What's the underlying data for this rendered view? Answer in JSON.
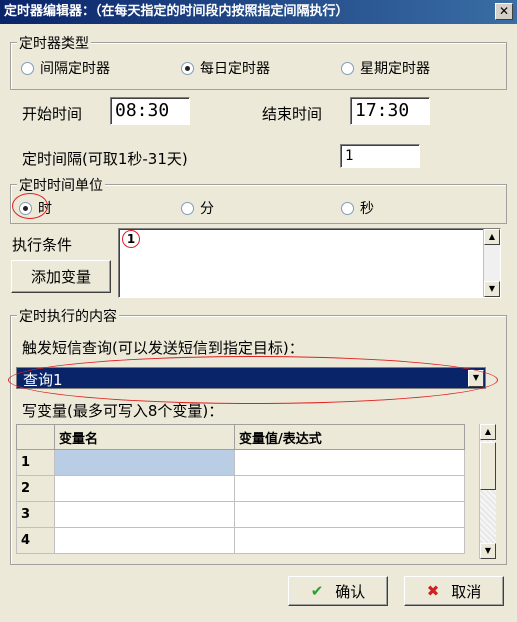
{
  "window": {
    "title": "定时器编辑器：（在每天指定的时间段内按照指定间隔执行）",
    "close_label": "✕"
  },
  "timer_type": {
    "title": "定时器类型",
    "options": [
      "间隔定时器",
      "每日定时器",
      "星期定时器"
    ],
    "selected": "每日定时器"
  },
  "time_range": {
    "start_label": "开始时间",
    "start_value": "08:30",
    "end_label": "结束时间",
    "end_value": "17:30"
  },
  "interval": {
    "label": "定时间隔(可取1秒-31天)",
    "value": "1"
  },
  "unit": {
    "title": "定时时间单位",
    "options": [
      "时",
      "分",
      "秒"
    ],
    "selected": "时",
    "marker": "1"
  },
  "condition": {
    "label": "执行条件",
    "add_var_label": "添加变量",
    "marker": "1",
    "value": ""
  },
  "content": {
    "title": "定时执行的内容",
    "trigger_label": "触发短信查询(可以发送短信到指定目标)：",
    "trigger_value": "查询1",
    "write_label": "写变量(最多可写入8个变量)：",
    "columns": [
      "",
      "变量名",
      "变量值/表达式"
    ],
    "rows": [
      {
        "index": "1",
        "name": "",
        "expr": ""
      },
      {
        "index": "2",
        "name": "",
        "expr": ""
      },
      {
        "index": "3",
        "name": "",
        "expr": ""
      },
      {
        "index": "4",
        "name": "",
        "expr": ""
      }
    ]
  },
  "buttons": {
    "ok_label": "确认",
    "cancel_label": "取消"
  },
  "colors": {
    "title_bar": "#0a246a",
    "selected_dropdown": "#0a246a",
    "annotation": "#e02020"
  }
}
